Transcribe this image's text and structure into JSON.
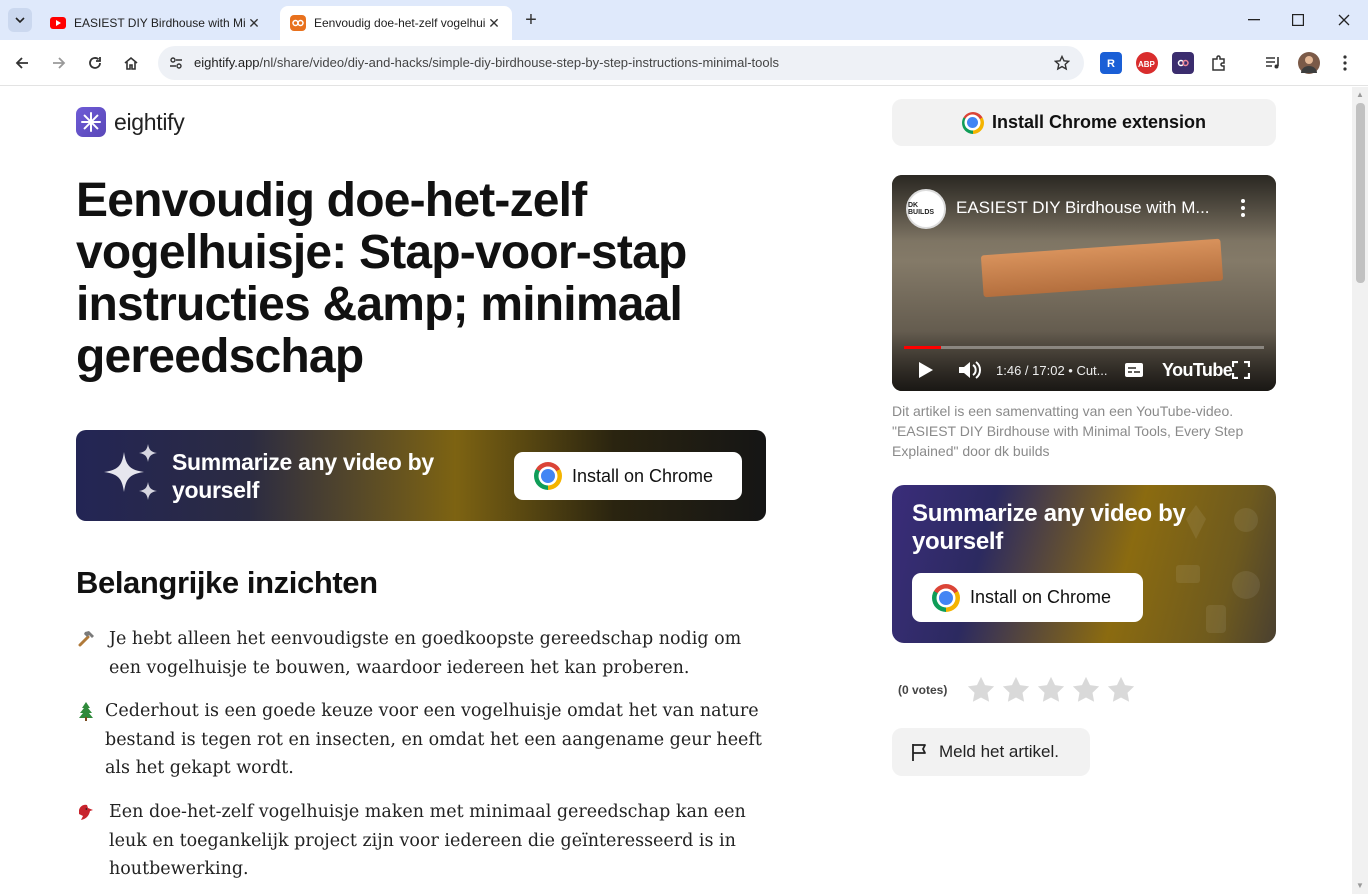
{
  "browser": {
    "tabs": [
      {
        "title": "EASIEST DIY Birdhouse with Minimal Tools",
        "favicon": "youtube-icon",
        "active": false
      },
      {
        "title": "Eenvoudig doe-het-zelf vogelhuisje",
        "favicon": "eightify-icon",
        "active": true
      }
    ],
    "url_domain": "eightify.app",
    "url_path": "/nl/share/video/diy-and-hacks/simple-diy-birdhouse-step-by-step-instructions-minimal-tools"
  },
  "page": {
    "logo_text": "eightify",
    "headline": "Eenvoudig doe-het-zelf vogelhuisje: Stap-voor-stap instructies &amp; minimaal gereedschap",
    "promo_wide": {
      "text": "Summarize any video by yourself",
      "button": "Install on Chrome"
    },
    "section_title": "Belangrijke inzichten",
    "insights": [
      {
        "emoji": "hammer",
        "text": "Je hebt alleen het eenvoudigste en goedkoopste gereedschap nodig om een vogelhuisje te bouwen, waardoor iedereen het kan proberen."
      },
      {
        "emoji": "evergreen-tree",
        "text": "Cederhout is een goede keuze voor een vogelhuisje omdat het van nature bestand is tegen rot en insecten, en omdat het een aangename geur heeft als het gekapt wordt."
      },
      {
        "emoji": "cardinal-bird",
        "text": "Een doe-het-zelf vogelhuisje maken met minimaal gereedschap kan een leuk en toegankelijk project zijn voor iedereen die geïnteresseerd is in houtbewerking."
      }
    ],
    "sidebar": {
      "extension_button": "Install Chrome extension",
      "video": {
        "title": "EASIEST DIY Birdhouse with M...",
        "channel_badge": "DK BUILDS",
        "time": "1:46 / 17:02 • Cut...",
        "progress": 0.104,
        "brand": "YouTube"
      },
      "caption": "Dit artikel is een samenvatting van een YouTube-video. \"EASIEST DIY Birdhouse with Minimal Tools, Every Step Explained\" door dk builds",
      "promo_card": {
        "text": "Summarize any video by yourself",
        "button": "Install on Chrome"
      },
      "votes": "(0 votes)",
      "rating": 0,
      "report_button": "Meld het artikel."
    }
  }
}
